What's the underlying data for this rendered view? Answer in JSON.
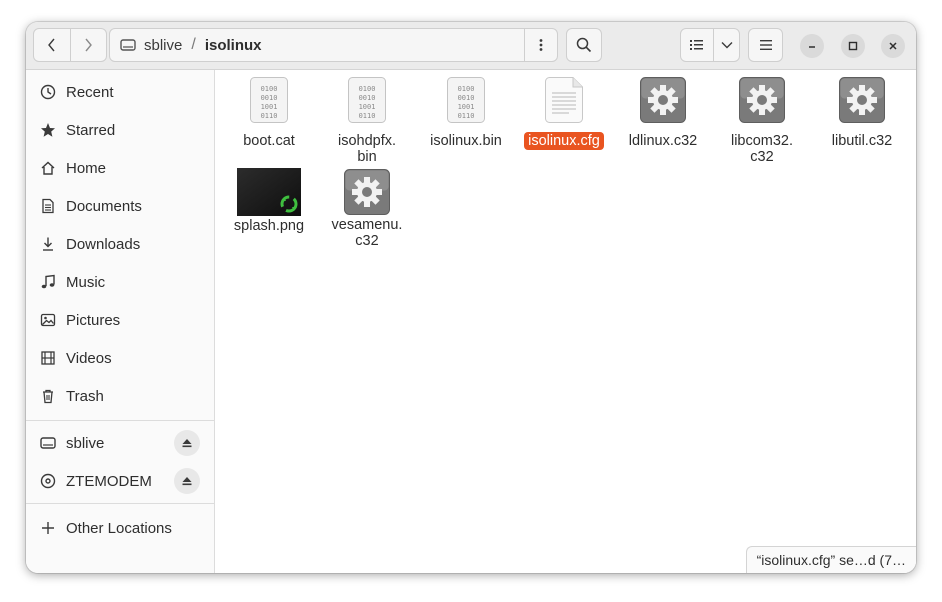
{
  "window": {
    "path": [
      {
        "label": "sblive",
        "icon": "drive-icon"
      },
      {
        "label": "isolinux",
        "current": true
      }
    ],
    "path_separator": "/"
  },
  "sidebar": {
    "places": [
      {
        "label": "Recent",
        "icon": "clock-icon"
      },
      {
        "label": "Starred",
        "icon": "star-icon"
      },
      {
        "label": "Home",
        "icon": "home-icon"
      },
      {
        "label": "Documents",
        "icon": "document-icon"
      },
      {
        "label": "Downloads",
        "icon": "download-icon"
      },
      {
        "label": "Music",
        "icon": "music-icon"
      },
      {
        "label": "Pictures",
        "icon": "picture-icon"
      },
      {
        "label": "Videos",
        "icon": "video-icon"
      },
      {
        "label": "Trash",
        "icon": "trash-icon"
      }
    ],
    "devices": [
      {
        "label": "sblive",
        "icon": "drive-icon"
      },
      {
        "label": "ZTEMODEM",
        "icon": "disc-icon"
      }
    ],
    "other": {
      "label": "Other Locations",
      "icon": "plus-icon"
    }
  },
  "files": [
    {
      "name": "boot.cat",
      "type": "binary"
    },
    {
      "name": "isohdpfx.\nbin",
      "type": "binary"
    },
    {
      "name": "isolinux.bin",
      "type": "binary"
    },
    {
      "name": "isolinux.cfg",
      "type": "text",
      "selected": true
    },
    {
      "name": "ldlinux.c32",
      "type": "executable"
    },
    {
      "name": "libcom32.\nc32",
      "type": "executable"
    },
    {
      "name": "libutil.c32",
      "type": "executable"
    },
    {
      "name": "splash.png",
      "type": "image"
    },
    {
      "name": "vesamenu.\nc32",
      "type": "executable"
    }
  ],
  "status": {
    "text": "“isolinux.cfg” se…d (7…"
  },
  "colors": {
    "accent": "#e95420",
    "sidebar_bg": "#fafafa",
    "header_bg": "#ebebeb"
  }
}
